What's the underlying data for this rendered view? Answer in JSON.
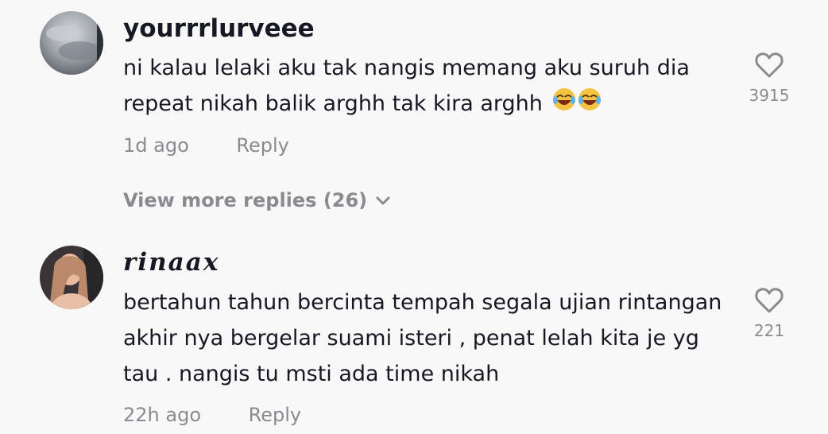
{
  "comments": [
    {
      "username": "yourrrlurveee",
      "text": "ni kalau lelaki aku tak nangis memang aku suruh dia repeat nikah balik arghh tak kira arghh",
      "emojis": "😂😂",
      "time": "1d ago",
      "reply_label": "Reply",
      "likes": "3915",
      "view_more": "View more replies (26)"
    },
    {
      "username": "rinaax",
      "text": "bertahun tahun bercinta tempah segala ujian rintangan akhir nya bergelar suami isteri , penat lelah kita je yg tau . nangis tu msti ada time nikah",
      "time": "22h ago",
      "reply_label": "Reply",
      "likes": "221"
    }
  ],
  "icons": {
    "like": "heart-outline-icon",
    "expand": "chevron-down-icon"
  },
  "colors": {
    "background": "#f8f8f8",
    "text": "#161823",
    "muted": "#8a8b91"
  }
}
